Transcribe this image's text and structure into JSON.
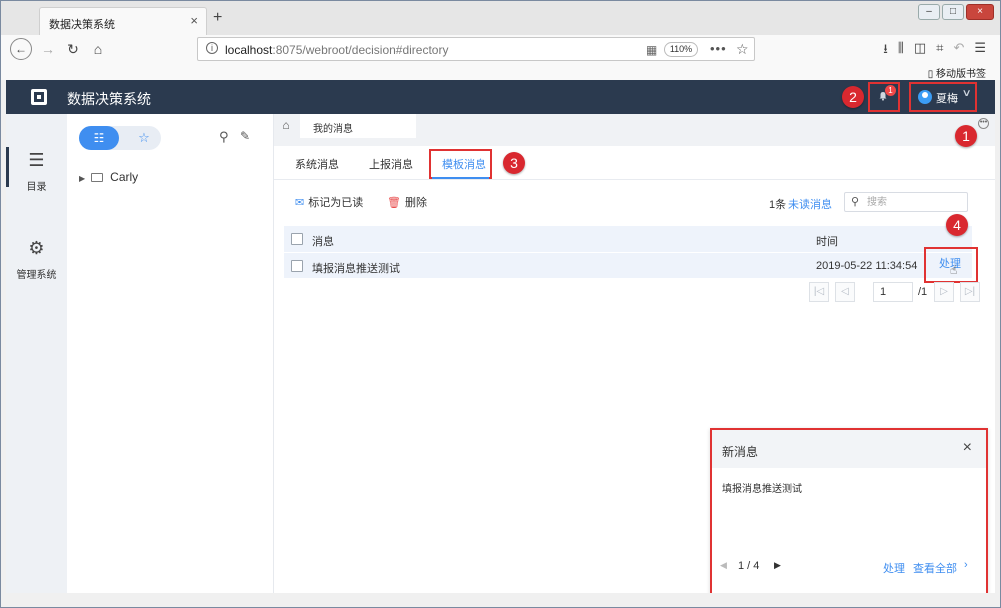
{
  "browser": {
    "tab_title": "数据决策系统",
    "tab_close": "×",
    "new_tab": "+",
    "window_controls": [
      "–",
      "□",
      "×"
    ],
    "url_host": "localhost",
    "url_rest": ":8075/webroot/decision#directory",
    "zoom": "110%",
    "bookmark_label": "移动版书签",
    "toolbar_icons": [
      "download-icon",
      "library-icon",
      "sidebar-icon",
      "screenshot-icon",
      "undo-icon",
      "menu-icon"
    ]
  },
  "app": {
    "title": "数据决策系统",
    "notification_count": "1",
    "user_name": "夏梅"
  },
  "sidebar": {
    "items": [
      {
        "label": "目录",
        "icon": "list-icon"
      },
      {
        "label": "管理系统",
        "icon": "gear-icon"
      }
    ]
  },
  "tree": {
    "nodes": [
      {
        "label": "Carly"
      }
    ]
  },
  "breadcrumb": {
    "page_tab": "我的消息"
  },
  "subtabs": [
    {
      "label": "系统消息"
    },
    {
      "label": "上报消息"
    },
    {
      "label": "模板消息",
      "active": true
    }
  ],
  "actions": {
    "mark_read": "标记为已读",
    "delete": "删除",
    "unread_count": "1条",
    "unread_label": "未读消息",
    "search_placeholder": "搜索"
  },
  "table": {
    "columns": [
      "消息",
      "时间"
    ],
    "rows": [
      {
        "message": "填报消息推送测试",
        "time": "2019-05-22 11:34:54",
        "action": "处理"
      }
    ]
  },
  "pager": {
    "current": "1",
    "total": "/1"
  },
  "popup": {
    "title": "新消息",
    "message": "填报消息推送测试",
    "page": "1 / 4",
    "handle": "处理",
    "view_all": "查看全部"
  },
  "annotations": [
    "1",
    "2",
    "3",
    "4"
  ],
  "colors": {
    "header_bg": "#2b3a4f",
    "accent": "#3f8ef0",
    "annotation_red": "#d9282f"
  }
}
